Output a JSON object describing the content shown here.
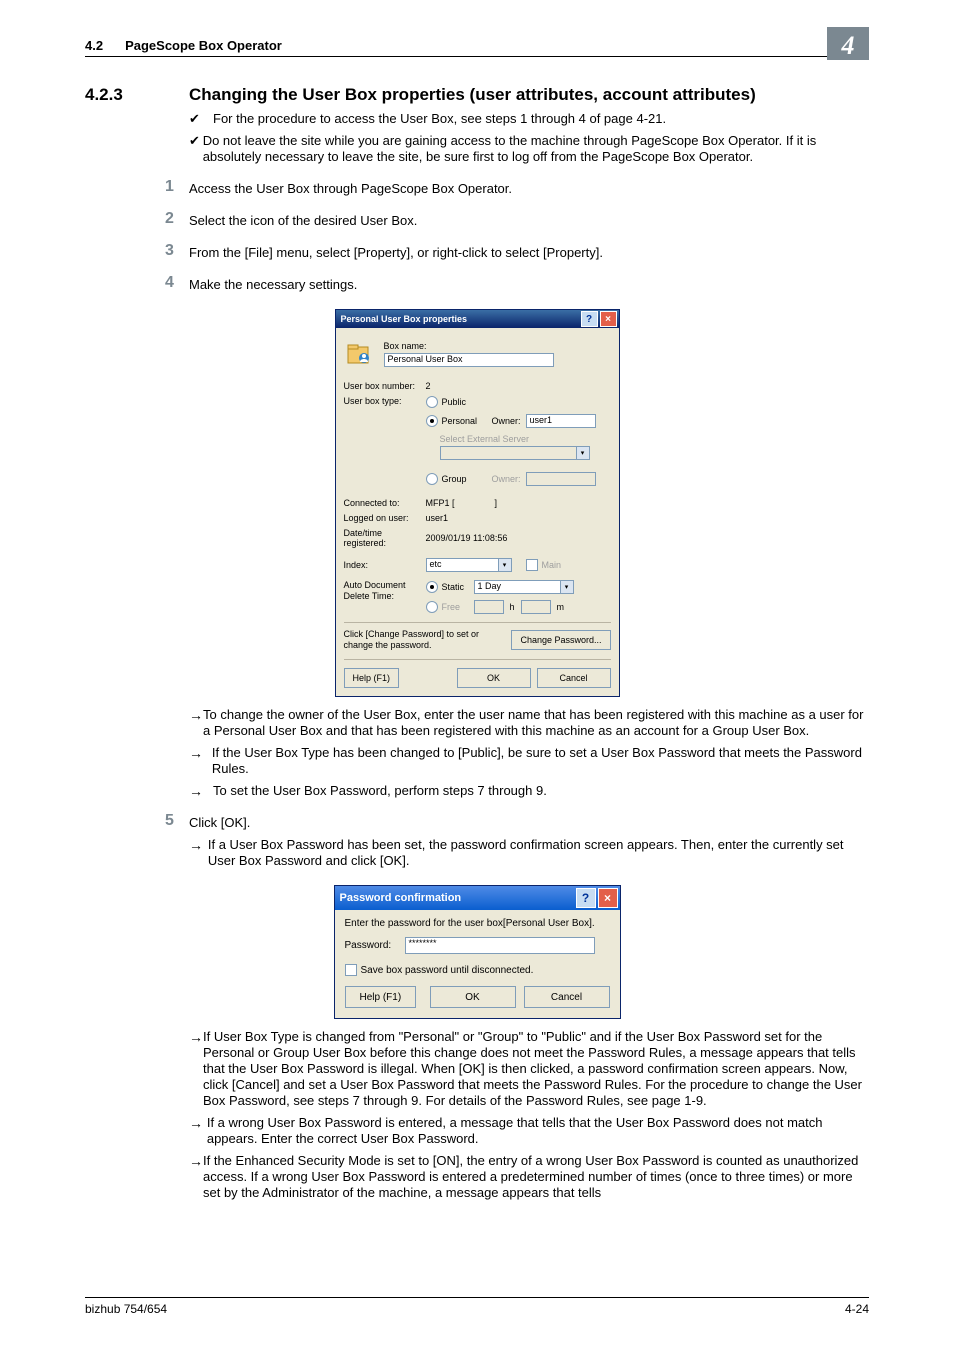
{
  "header": {
    "section_num": "4.2",
    "section_title": "PageScope Box Operator",
    "chapter": "4"
  },
  "section": {
    "num": "4.2.3",
    "title": "Changing the User Box properties (user attributes, account attributes)"
  },
  "checks": [
    "For the procedure to access the User Box, see steps 1 through 4 of page 4-21.",
    "Do not leave the site while you are gaining access to the machine through PageScope Box Operator. If it is absolutely necessary to leave the site, be sure first to log off from the PageScope Box Operator."
  ],
  "steps": {
    "s1": "Access the User Box through PageScope Box Operator.",
    "s2": "Select the icon of the desired User Box.",
    "s3": "From the [File] menu, select [Property], or right-click to select [Property].",
    "s4": "Make the necessary settings.",
    "s5": "Click [OK]."
  },
  "arrows4": [
    "To change the owner of the User Box, enter the user name that has been registered with this machine as a user for a Personal User Box and that has been registered with this machine as an account for a Group User Box.",
    "If the User Box Type has been changed to [Public], be sure to set a User Box Password that meets the Password Rules.",
    "To set the User Box Password, perform steps 7 through 9."
  ],
  "arrows5a": [
    "If a User Box Password has been set, the password confirmation screen appears. Then, enter the currently set User Box Password and click [OK]."
  ],
  "arrows5b": [
    "If User Box Type is changed from \"Personal\" or \"Group\" to \"Public\" and if the User Box Password set for the Personal or Group User Box before this change does not meet the Password Rules, a message appears that tells that the User Box Password is illegal. When [OK] is then clicked, a password confirmation screen appears. Now, click [Cancel] and set a User Box Password that meets the Password Rules. For the procedure to change the User Box Password, see steps 7 through 9. For details of the Password Rules, see page 1-9.",
    "If a wrong User Box Password is entered, a message that tells that the User Box Password does not match appears. Enter the correct User Box Password.",
    "If the Enhanced Security Mode is set to [ON], the entry of a wrong User Box Password is counted as unauthorized access. If a wrong User Box Password is entered a predetermined number of times (once to three times) or more set by the Administrator of the machine, a message appears that tells"
  ],
  "dlg1": {
    "title": "Personal User Box properties",
    "boxname_lbl": "Box name:",
    "boxname_val": "Personal User Box",
    "userboxnum_lbl": "User box number:",
    "userboxnum_val": "2",
    "userboxtype_lbl": "User box type:",
    "public": "Public",
    "personal": "Personal",
    "owner_lbl": "Owner:",
    "owner_val": "user1",
    "select_ext": "Select External Server",
    "group": "Group",
    "owner2_lbl": "Owner:",
    "connected_lbl": "Connected to:",
    "connected_val": "MFP1 [",
    "logged_lbl": "Logged on user:",
    "logged_val": "user1",
    "date_lbl": "Date/time registered:",
    "date_val": "2009/01/19 11:08:56",
    "index_lbl": "Index:",
    "index_val": "etc",
    "main": "Main",
    "auto_lbl": "Auto Document Delete Time:",
    "static": "Static",
    "static_val": "1 Day",
    "free": "Free",
    "h": "h",
    "m": "m",
    "chg_text": "Click [Change Password] to set or change the password.",
    "chg_btn": "Change Password...",
    "help": "Help (F1)",
    "ok": "OK",
    "cancel": "Cancel"
  },
  "dlg2": {
    "title": "Password confirmation",
    "msg": "Enter the password for the user box[Personal User Box].",
    "pwd_lbl": "Password:",
    "pwd_val": "********",
    "save": "Save box password until disconnected.",
    "help": "Help (F1)",
    "ok": "OK",
    "cancel": "Cancel"
  },
  "footer": {
    "left": "bizhub 754/654",
    "right": "4-24"
  }
}
